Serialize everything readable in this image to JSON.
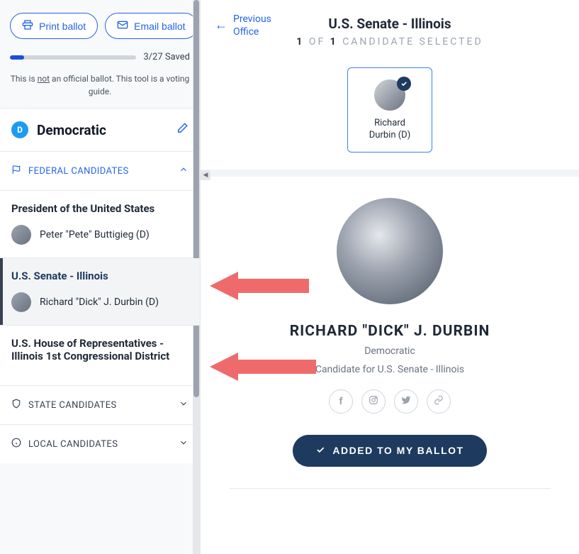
{
  "sidebar": {
    "print_label": "Print ballot",
    "email_label": "Email ballot",
    "progress_text": "3/27 Saved",
    "disclaimer_pre": "This is ",
    "disclaimer_not": "not",
    "disclaimer_post": " an official ballot. This tool is a voting guide.",
    "party_letter": "D",
    "party_name": "Democratic",
    "sections": {
      "federal": {
        "label": "FEDERAL CANDIDATES"
      },
      "state": {
        "label": "STATE CANDIDATES"
      },
      "local": {
        "label": "LOCAL CANDIDATES"
      }
    },
    "races": [
      {
        "title": "President of the United States",
        "candidate": "Peter \"Pete\" Buttigieg (D)"
      },
      {
        "title": "U.S. Senate - Illinois",
        "candidate": "Richard \"Dick\" J. Durbin (D)"
      },
      {
        "title": "U.S. House of Representatives - Illinois 1st Congressional District",
        "candidate": null
      }
    ]
  },
  "main": {
    "prev_link_l1": "Previous",
    "prev_link_l2": "Office",
    "race_name": "U.S. Senate - Illinois",
    "status_n1": "1",
    "status_of": " OF ",
    "status_n2": "1",
    "status_rest": " CANDIDATE SELECTED",
    "card": {
      "line1": "Richard",
      "line2": "Durbin (D)"
    },
    "profile": {
      "name": "RICHARD \"DICK\" J. DURBIN",
      "party": "Democratic",
      "office": "Candidate for U.S. Senate - Illinois",
      "button": "ADDED TO MY BALLOT"
    }
  },
  "colors": {
    "accent": "#2563eb",
    "primary_dark": "#1e3a5f",
    "arrow": "#ef6b6b"
  }
}
